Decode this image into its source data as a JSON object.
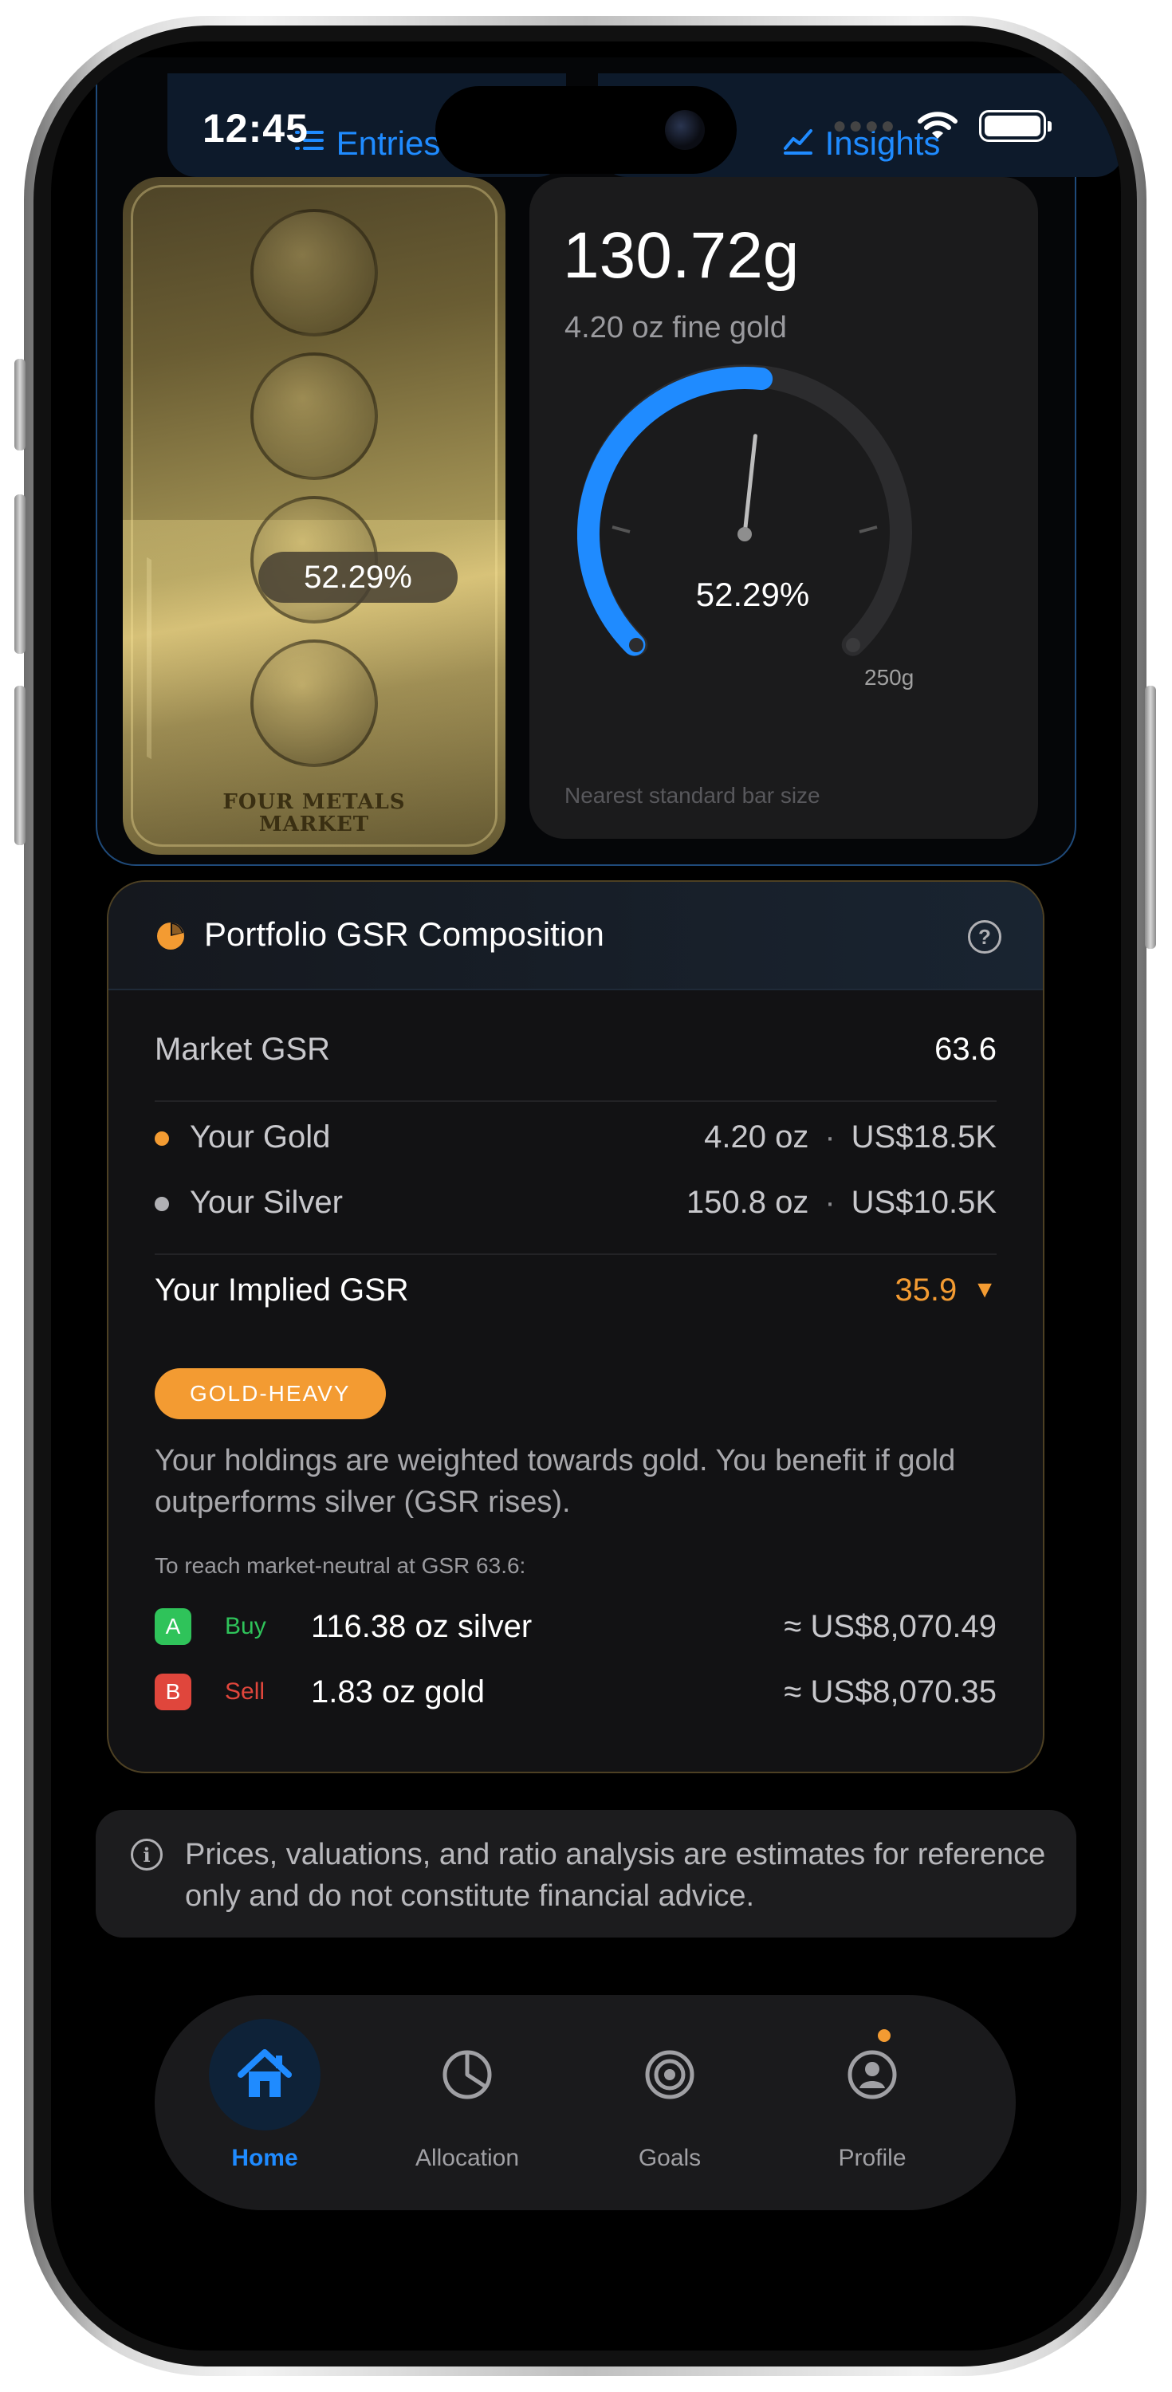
{
  "status_bar": {
    "time": "12:45"
  },
  "top_tabs": [
    {
      "label": "Entries",
      "icon": "list-icon"
    },
    {
      "label": "Insights",
      "icon": "chart-line-icon"
    }
  ],
  "hero": {
    "bar_percent": "52.29%",
    "bar_logo_line1": "Four Metals",
    "bar_logo_line2": "Market",
    "weight": "130.72g",
    "weight_sub": "4.20 oz fine gold",
    "gauge_percent": "52.29%",
    "gauge_fill_fraction": 0.5229,
    "gauge_max_label": "250g",
    "note": "Nearest standard bar size",
    "accent": "#1f8bff"
  },
  "gsr": {
    "title": "Portfolio GSR Composition",
    "market_label": "Market GSR",
    "market_value": "63.6",
    "gold_label": "Your Gold",
    "gold_oz": "4.20 oz",
    "gold_usd": "US$18.5K",
    "silver_label": "Your Silver",
    "silver_oz": "150.8 oz",
    "silver_usd": "US$10.5K",
    "separator": "·",
    "implied_label": "Your Implied GSR",
    "implied_value": "35.9",
    "implied_arrow": "▼",
    "badge": "GOLD-HEAVY",
    "explanation": "Your holdings are weighted towards gold. You benefit if gold outperforms silver (GSR rises).",
    "neutral_note": "To reach market-neutral at GSR 63.6:",
    "actions": [
      {
        "letter": "A",
        "verb": "Buy",
        "quantity": "116.38 oz silver",
        "amount": "≈ US$8,070.49",
        "color": "#2fc35a"
      },
      {
        "letter": "B",
        "verb": "Sell",
        "quantity": "1.83 oz gold",
        "amount": "≈ US$8,070.35",
        "color": "#e0463c"
      }
    ],
    "gold_color": "#f39b32",
    "silver_color": "#b0b0b4"
  },
  "disclaimer": "Prices, valuations, and ratio analysis are estimates for reference only and do not constitute financial advice.",
  "tabbar": [
    {
      "label": "Home",
      "icon": "home-icon",
      "active": true
    },
    {
      "label": "Allocation",
      "icon": "pie-chart-icon",
      "active": false
    },
    {
      "label": "Goals",
      "icon": "target-icon",
      "active": false
    },
    {
      "label": "Profile",
      "icon": "profile-icon",
      "active": false
    }
  ]
}
